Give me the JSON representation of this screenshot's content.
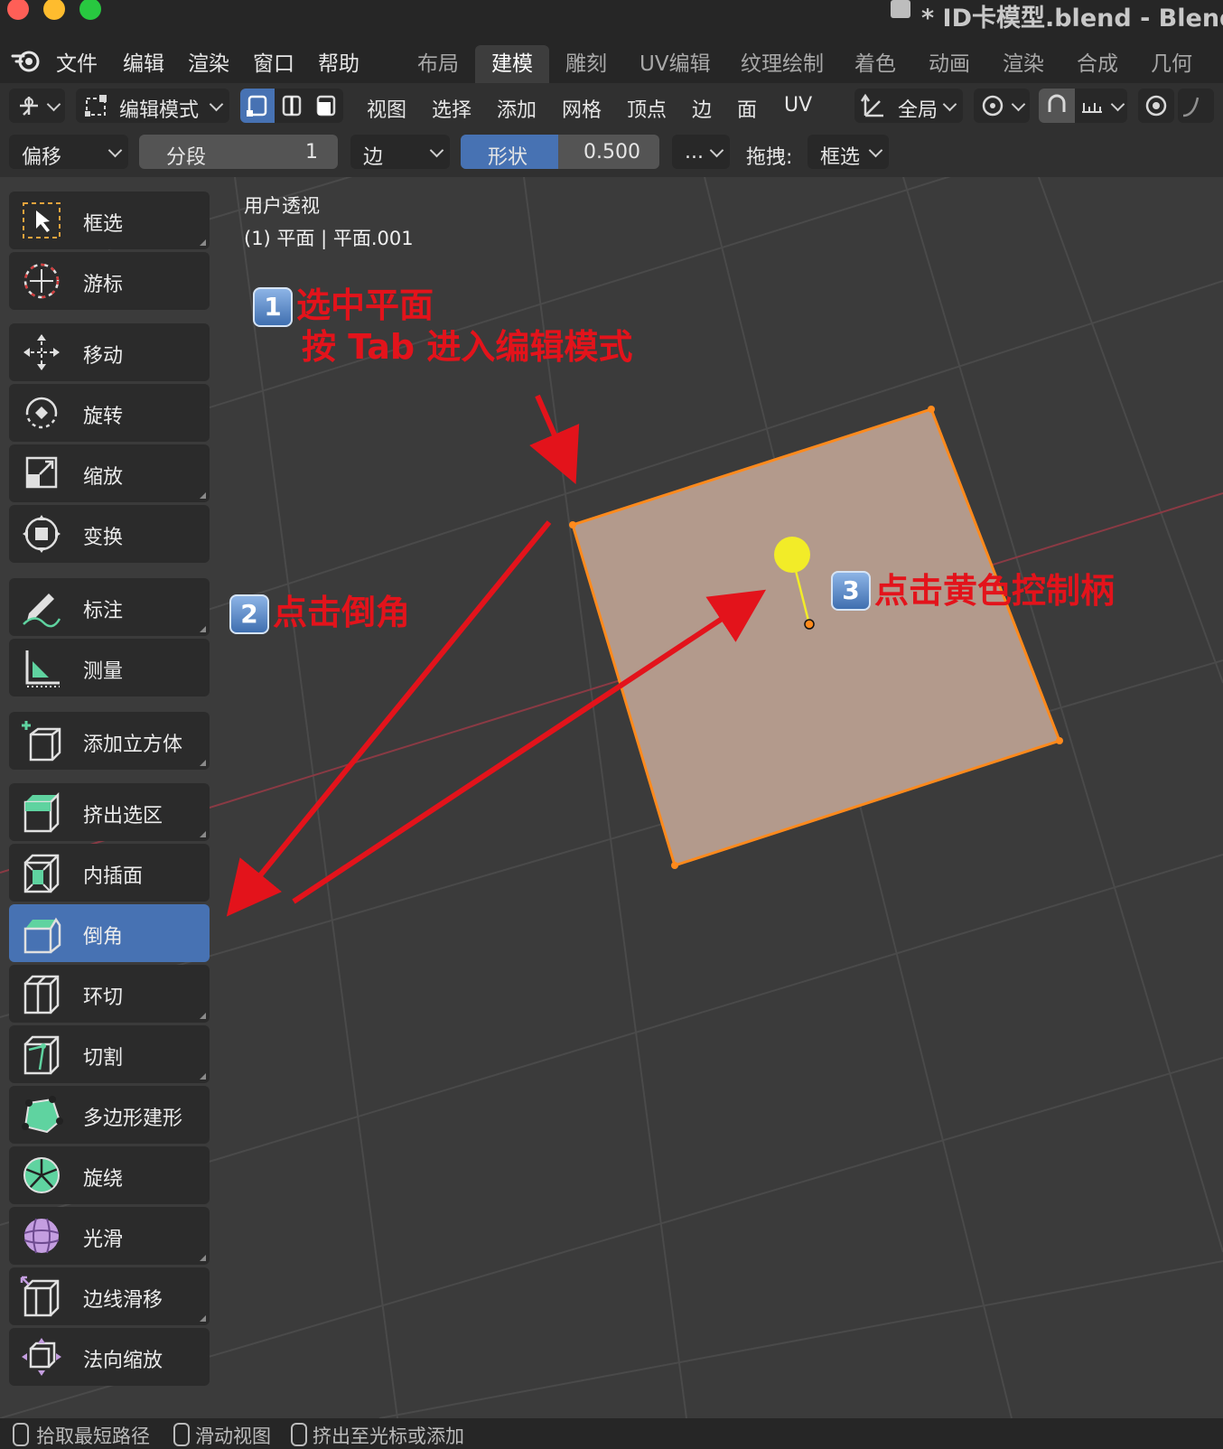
{
  "window": {
    "title": "* ID卡模型.blend - Blender"
  },
  "menu": [
    "文件",
    "编辑",
    "渲染",
    "窗口",
    "帮助"
  ],
  "workspace_tabs": [
    {
      "label": "布局",
      "active": false
    },
    {
      "label": "建模",
      "active": true
    },
    {
      "label": "雕刻",
      "active": false
    },
    {
      "label": "UV编辑",
      "active": false
    },
    {
      "label": "纹理绘制",
      "active": false
    },
    {
      "label": "着色",
      "active": false
    },
    {
      "label": "动画",
      "active": false
    },
    {
      "label": "渲染",
      "active": false
    },
    {
      "label": "合成",
      "active": false
    },
    {
      "label": "几何节",
      "active": false
    }
  ],
  "header": {
    "mode": "编辑模式",
    "menus": [
      "视图",
      "选择",
      "添加",
      "网格",
      "顶点",
      "边",
      "面",
      "UV"
    ],
    "transform_orientation": "全局"
  },
  "operator_bar": {
    "type": "偏移",
    "segments_label": "分段",
    "segments_value": "1",
    "affect": "边",
    "shape_label": "形状",
    "shape_value": "0.500",
    "more": "...",
    "drag_label": "拖拽:",
    "drag_value": "框选"
  },
  "viewport": {
    "view_name": "用户透视",
    "object_info": "(1) 平面 | 平面.001"
  },
  "tools": [
    {
      "label": "框选",
      "icon": "select-box-icon",
      "active": false
    },
    {
      "label": "游标",
      "icon": "cursor-icon",
      "active": false
    },
    {
      "label": "移动",
      "icon": "move-icon",
      "active": false
    },
    {
      "label": "旋转",
      "icon": "rotate-icon",
      "active": false
    },
    {
      "label": "缩放",
      "icon": "scale-icon",
      "active": false
    },
    {
      "label": "变换",
      "icon": "transform-icon",
      "active": false
    },
    {
      "label": "标注",
      "icon": "annotate-icon",
      "active": false
    },
    {
      "label": "测量",
      "icon": "measure-icon",
      "active": false
    },
    {
      "label": "添加立方体",
      "icon": "add-cube-icon",
      "active": false
    },
    {
      "label": "挤出选区",
      "icon": "extrude-icon",
      "active": false
    },
    {
      "label": "内插面",
      "icon": "inset-icon",
      "active": false
    },
    {
      "label": "倒角",
      "icon": "bevel-icon",
      "active": true
    },
    {
      "label": "环切",
      "icon": "loop-cut-icon",
      "active": false
    },
    {
      "label": "切割",
      "icon": "knife-icon",
      "active": false
    },
    {
      "label": "多边形建形",
      "icon": "poly-build-icon",
      "active": false
    },
    {
      "label": "旋绕",
      "icon": "spin-icon",
      "active": false
    },
    {
      "label": "光滑",
      "icon": "smooth-icon",
      "active": false
    },
    {
      "label": "边线滑移",
      "icon": "edge-slide-icon",
      "active": false
    },
    {
      "label": "法向缩放",
      "icon": "shrink-fatten-icon",
      "active": false
    }
  ],
  "annotations": {
    "step1_badge": "1",
    "step1_line1": "选中平面",
    "step1_line2": "按 Tab 进入编辑模式",
    "step2_badge": "2",
    "step2_text": "点击倒角",
    "step3_badge": "3",
    "step3_text": "点击黄色控制柄"
  },
  "status_bar": [
    "拾取最短路径",
    "滑动视图",
    "挤出至光标或添加"
  ],
  "colors": {
    "accent": "#4772b3",
    "annotation_red": "#e3131b",
    "selected_face": "#b39a8c",
    "selected_edge": "#ff8a1c",
    "gizmo_yellow": "#f2ec28"
  }
}
